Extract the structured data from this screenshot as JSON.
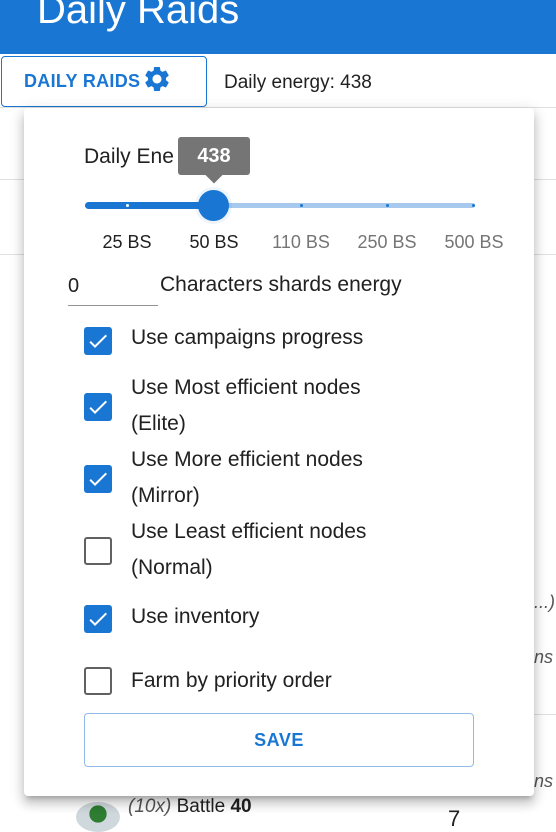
{
  "app": {
    "title": "Daily Raids"
  },
  "toolbar": {
    "daily_raids_button": "DAILY RAIDS",
    "daily_energy_text": "Daily energy: 438"
  },
  "background": {
    "text_a": "...)",
    "text_b": "ns",
    "text_c": "ns",
    "row_count": "(10x)",
    "row_label": "Battle",
    "row_value": "40",
    "row_number": "7"
  },
  "popover": {
    "slider": {
      "label": "Daily Ene",
      "value": 438,
      "value_label": "438",
      "active_fraction": 0.25,
      "marks": [
        "25 BS",
        "50 BS",
        "110 BS",
        "250 BS",
        "500 BS"
      ]
    },
    "shards": {
      "value": "0",
      "label": "Characters shards energy"
    },
    "checkboxes": [
      {
        "line1": "Use campaigns progress",
        "line2": "",
        "checked": true
      },
      {
        "line1": "Use Most efficient nodes",
        "line2": "(Elite)",
        "checked": true
      },
      {
        "line1": "Use More efficient nodes",
        "line2": "(Mirror)",
        "checked": true
      },
      {
        "line1": "Use Least efficient nodes",
        "line2": "(Normal)",
        "checked": false
      },
      {
        "line1": "Use inventory",
        "line2": "",
        "checked": true
      },
      {
        "line1": "Farm by priority order",
        "line2": "",
        "checked": false
      }
    ],
    "save_label": "SAVE"
  },
  "colors": {
    "primary": "#1976d2",
    "rail": "#a8c9ee",
    "tooltip": "#757575"
  },
  "icons": {
    "settings": "gear-icon",
    "check": "check-icon"
  }
}
